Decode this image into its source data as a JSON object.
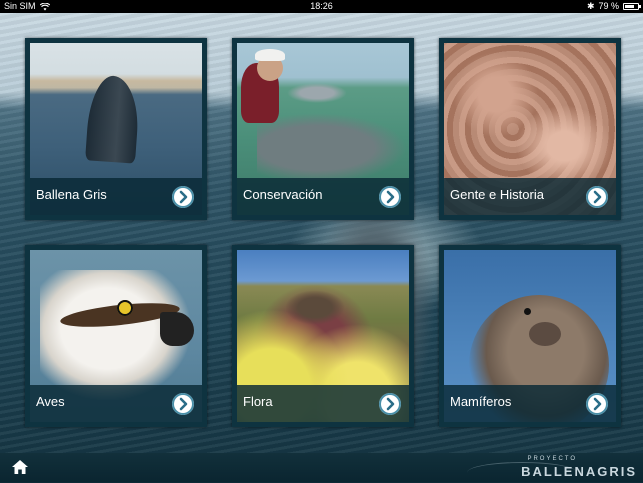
{
  "status_bar": {
    "carrier": "Sin SIM",
    "time": "18:26",
    "battery": "79 %",
    "battery_level": 0.79
  },
  "tiles": [
    {
      "label": "Ballena Gris",
      "icon": "chevron-right-icon"
    },
    {
      "label": "Conservación",
      "icon": "chevron-right-icon"
    },
    {
      "label": "Gente e Historia",
      "icon": "chevron-right-icon"
    },
    {
      "label": "Aves",
      "icon": "chevron-right-icon"
    },
    {
      "label": "Flora",
      "icon": "chevron-right-icon"
    },
    {
      "label": "Mamíferos",
      "icon": "chevron-right-icon"
    }
  ],
  "footer": {
    "home_icon": "home-icon",
    "brand_small": "PROYECTO",
    "brand_name": "BALLENAGRIS"
  },
  "colors": {
    "tile_frame": "#0e3340",
    "button_ring": "#4a8fa8",
    "status_bg": "#000000"
  }
}
